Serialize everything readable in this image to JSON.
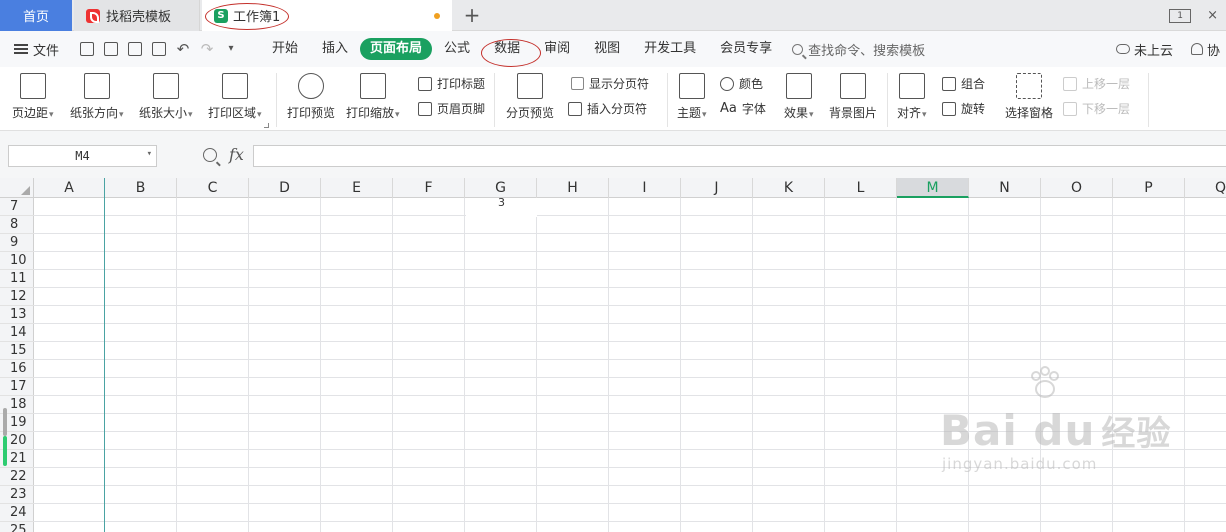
{
  "tabbar": {
    "home": "首页",
    "docer": "找稻壳模板",
    "workbook": "工作簿1",
    "workbook_icon": "S",
    "add": "+",
    "window_mode": "1",
    "close": "×"
  },
  "menubar": {
    "file": "文件",
    "tabs": [
      "开始",
      "插入",
      "页面布局",
      "公式",
      "数据",
      "审阅",
      "视图",
      "开发工具",
      "会员专享"
    ],
    "active_tab": "页面布局",
    "search": "查找命令、搜索模板",
    "cloud": "未上云",
    "collab": "协"
  },
  "ribbon": {
    "margins": "页边距",
    "orientation": "纸张方向",
    "size": "纸张大小",
    "print_area": "打印区域",
    "print_preview": "打印预览",
    "print_scale": "打印缩放",
    "print_titles": "打印标题",
    "header_footer": "页眉页脚",
    "page_break_preview": "分页预览",
    "show_page_breaks": "显示分页符",
    "insert_page_break": "插入分页符",
    "theme": "主题",
    "colors": "颜色",
    "fonts": "字体",
    "fonts_prefix": "Aa",
    "effects": "效果",
    "background": "背景图片",
    "align": "对齐",
    "group": "组合",
    "rotate": "旋转",
    "selection_pane": "选择窗格",
    "bring_forward": "上移一层",
    "send_backward": "下移一层"
  },
  "formula_bar": {
    "name_box": "M4",
    "fx": "fx",
    "value": ""
  },
  "grid": {
    "columns": [
      "A",
      "B",
      "C",
      "D",
      "E",
      "F",
      "G",
      "H",
      "I",
      "J",
      "K",
      "L",
      "M",
      "N",
      "O",
      "P",
      "Q"
    ],
    "selected_column": "M",
    "rows": [
      "7",
      "8",
      "9",
      "10",
      "11",
      "12",
      "13",
      "14",
      "15",
      "16",
      "17",
      "18",
      "19",
      "20",
      "21",
      "22",
      "23",
      "24",
      "25"
    ],
    "cell_g_text": "3"
  },
  "watermark": {
    "brand": "Bai  du",
    "brand_cn": "经验",
    "url": "jingyan.baidu.com"
  },
  "colors": {
    "accent_green": "#1aa060",
    "home_tab_blue": "#4a7fe0",
    "annotation_red": "#c4302b"
  }
}
